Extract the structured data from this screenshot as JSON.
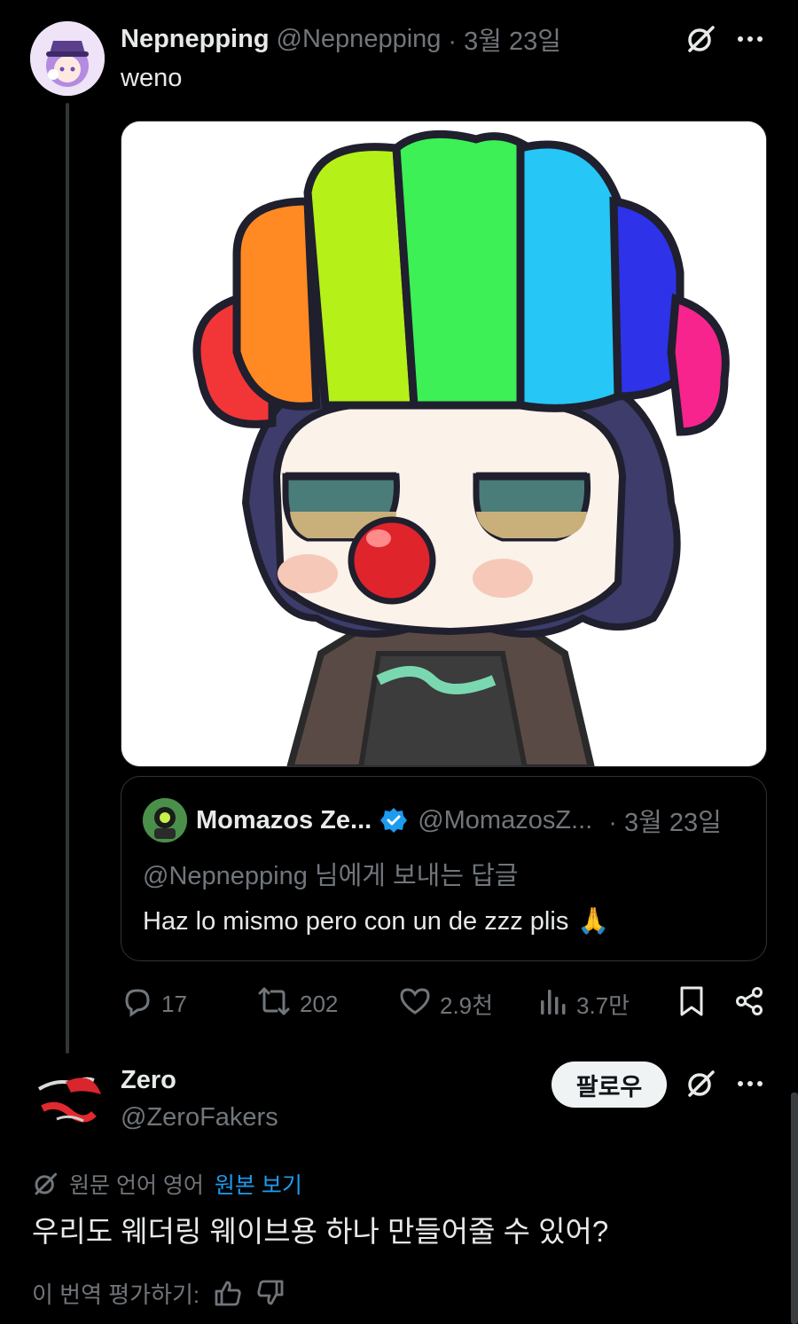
{
  "tweet": {
    "author_name": "Nepnepping",
    "author_handle": "@Nepnepping",
    "date": "· 3월 23일",
    "text": "weno",
    "quote": {
      "author_name": "Momazos Ze...",
      "author_handle": "@MomazosZ...",
      "date": "· 3월 23일",
      "reply_to": "@Nepnepping 님에게 보내는 답글",
      "text": "Haz lo mismo pero con un de zzz plis",
      "emoji": "🙏"
    },
    "actions": {
      "replies": "17",
      "retweets": "202",
      "likes": "2.9천",
      "views": "3.7만"
    }
  },
  "reply": {
    "author_name": "Zero",
    "author_handle": "@ZeroFakers",
    "follow_label": "팔로우",
    "translation_note": "원문 언어 영어",
    "show_original": "원본 보기",
    "text": "우리도 웨더링 웨이브용 하나 만들어줄 수 있어?",
    "rate_prompt": "이 번역 평가하기:"
  },
  "colors": {
    "background": "#000000",
    "text_primary": "#e7e9ea",
    "text_secondary": "#71767b",
    "link": "#1d9bf0",
    "verified": "#1d9bf0",
    "border": "#2f3336"
  },
  "icons": [
    "grok-icon",
    "more-icon",
    "reply-icon",
    "retweet-icon",
    "like-icon",
    "views-icon",
    "bookmark-icon",
    "share-icon",
    "verified-badge-icon",
    "thumbs-up-icon",
    "thumbs-down-icon"
  ]
}
